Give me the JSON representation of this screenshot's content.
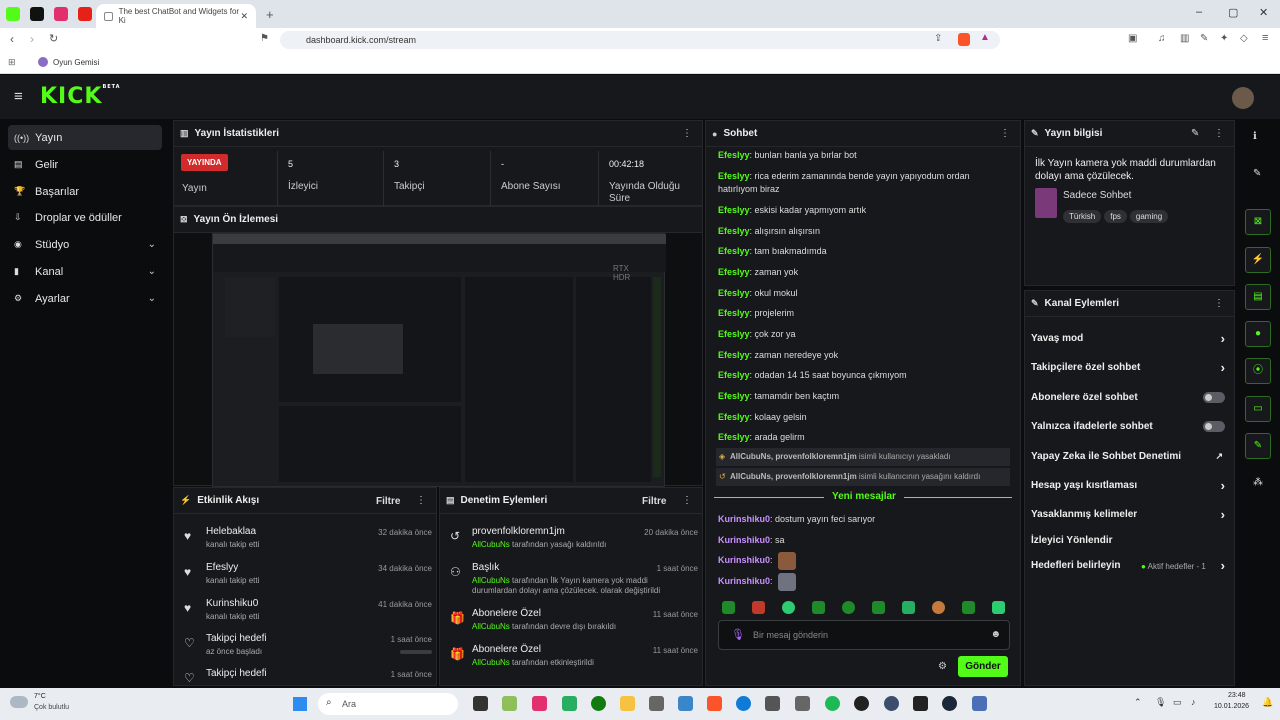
{
  "browser": {
    "tab_title": "The best ChatBot and Widgets for Ki",
    "url": "dashboard.kick.com/stream",
    "bookmark": "Oyun Gemisi",
    "win_buttons": [
      "–",
      "▢",
      "✕"
    ]
  },
  "brand": {
    "logo": "KICK",
    "logo_sup": "BETA"
  },
  "sidebar": {
    "items": [
      {
        "label": "Yayın",
        "icon": "((•))",
        "active": true
      },
      {
        "label": "Gelir",
        "icon": "▤"
      },
      {
        "label": "Başarılar",
        "icon": "🏆"
      },
      {
        "label": "Droplar ve ödüller",
        "icon": "⇩"
      },
      {
        "label": "Stüdyo",
        "icon": "◉",
        "chevron": "⌄"
      },
      {
        "label": "Kanal",
        "icon": "▮",
        "chevron": "⌄"
      },
      {
        "label": "Ayarlar",
        "icon": "⚙",
        "chevron": "⌄"
      }
    ]
  },
  "stats": {
    "title": "Yayın İstatistikleri",
    "live_badge": "YAYINDA",
    "items": [
      {
        "value": "",
        "label": "Yayın"
      },
      {
        "value": "5",
        "label": "İzleyici"
      },
      {
        "value": "3",
        "label": "Takipçi"
      },
      {
        "value": "-",
        "label": "Abone Sayısı"
      },
      {
        "value": "00:42:18",
        "label": "Yayında Olduğu Süre"
      }
    ]
  },
  "preview": {
    "title": "Yayın Ön İzlemesi"
  },
  "activity": {
    "title": "Etkinlik Akışı",
    "filter": "Filtre",
    "items": [
      {
        "title": "Helebaklaa",
        "sub": "kanalı takip etti",
        "time": "32 dakika önce",
        "icon": "♥"
      },
      {
        "title": "Efeslyy",
        "sub": "kanalı takip etti",
        "time": "34 dakika önce",
        "icon": "♥"
      },
      {
        "title": "Kurinshiku0",
        "sub": "kanalı takip etti",
        "time": "41 dakika önce",
        "icon": "♥"
      },
      {
        "title": "Takipçi hedefi",
        "sub": "az önce başladı",
        "time": "1 saat önce",
        "icon": "♡"
      },
      {
        "title": "Takipçi hedefi",
        "sub": "",
        "time": "1 saat önce",
        "icon": "♡"
      }
    ]
  },
  "moderation": {
    "title": "Denetim Eylemleri",
    "filter": "Filtre",
    "items": [
      {
        "title": "provenfolkloremn1jm",
        "actor": "AllCubuNs",
        "text": " tarafından yasağı kaldırıldı",
        "time": "20 dakika önce",
        "icon": "↺"
      },
      {
        "title": "Başlık",
        "actor": "AllCubuNs",
        "text": " tarafından İlk Yayın kamera yok maddi durumlardan dolayı ama çözülecek. olarak değiştirildi",
        "time": "1 saat önce",
        "icon": "⚇"
      },
      {
        "title": "Abonelere Özel",
        "actor": "AllCubuNs",
        "text": " tarafından devre dışı bırakıldı",
        "time": "11 saat önce",
        "icon": "🎁"
      },
      {
        "title": "Abonelere Özel",
        "actor": "AllCubuNs",
        "text": " tarafından etkinleştirildi",
        "time": "11 saat önce",
        "icon": "🎁"
      }
    ]
  },
  "chat": {
    "title": "Sohbet",
    "messages": [
      {
        "user": "Efeslyy",
        "text": "bunları banla ya bırlar bot"
      },
      {
        "user": "Efeslyy",
        "text": "rica ederim zamanında bende yayın yapıyodum ordan hatırlıyom biraz"
      },
      {
        "user": "Efeslyy",
        "text": "eskisi kadar yapmıyom artık"
      },
      {
        "user": "Efeslyy",
        "text": "alışırsın alışırsın"
      },
      {
        "user": "Efeslyy",
        "text": "tam bıakmadımda"
      },
      {
        "user": "Efeslyy",
        "text": "zaman yok"
      },
      {
        "user": "Efeslyy",
        "text": "okul mokul"
      },
      {
        "user": "Efeslyy",
        "text": "projelerim"
      },
      {
        "user": "Efeslyy",
        "text": "çok zor ya"
      },
      {
        "user": "Efeslyy",
        "text": "zaman neredeye yok"
      },
      {
        "user": "Efeslyy",
        "text": "odadan 14 15 saat boyunca çıkmıyom"
      },
      {
        "user": "Efeslyy",
        "text": "tamamdır ben kaçtım"
      },
      {
        "user": "Efeslyy",
        "text": "kolaay gelsin"
      },
      {
        "user": "Efeslyy",
        "text": "arada gelirm"
      }
    ],
    "system": [
      {
        "bold": "AllCubuNs, provenfolkloremn1jm",
        "text": " isimli kullanıcıyı yasakladı"
      },
      {
        "bold": "AllCubuNs, provenfolkloremn1jm",
        "text": " isimli kullanıcının yasağını kaldırdı"
      }
    ],
    "new_messages": "Yeni mesajlar",
    "recent": [
      {
        "user": "Kurinshiku0",
        "text": "dostum yayın feci sarıyor"
      },
      {
        "user": "Kurinshiku0",
        "text": "sa"
      },
      {
        "user": "Kurinshiku0",
        "text": ""
      },
      {
        "user": "Kurinshiku0",
        "text": ""
      }
    ],
    "placeholder": "Bir mesaj gönderin",
    "send": "Gönder"
  },
  "stream_info": {
    "title": "Yayın bilgisi",
    "description": "İlk Yayın kamera yok maddi durumlardan dolayı ama çözülecek.",
    "category": "Sadece Sohbet",
    "tags": [
      "Türkish",
      "fps",
      "gaming"
    ]
  },
  "channel_actions": {
    "title": "Kanal Eylemleri",
    "rows": [
      {
        "label": "Yavaş mod",
        "control": "chevron"
      },
      {
        "label": "Takipçilere özel sohbet",
        "control": "chevron"
      },
      {
        "label": "Abonelere özel sohbet",
        "control": "toggle"
      },
      {
        "label": "Yalnızca ifadelerle sohbet",
        "control": "toggle"
      },
      {
        "label": "Yapay Zeka ile Sohbet Denetimi",
        "control": "external"
      },
      {
        "label": "Hesap yaşı kısıtlaması",
        "control": "chevron"
      },
      {
        "label": "Yasaklanmış kelimeler",
        "control": "chevron"
      },
      {
        "label": "İzleyici Yönlendir",
        "control": "none"
      },
      {
        "label": "Hedefleri belirleyin",
        "control": "chevron",
        "note": "Aktif hedefler - 1"
      }
    ]
  },
  "taskbar": {
    "weather_temp": "7°C",
    "weather_desc": "Çok bulutlu",
    "search": "Ara",
    "time": "23:48",
    "date": "10.01.2026"
  },
  "colors": {
    "accent": "#53fc18",
    "live": "#d12b2b",
    "panel": "#17181c",
    "bg": "#0b0c0e",
    "mod_user": "#c890ff"
  }
}
